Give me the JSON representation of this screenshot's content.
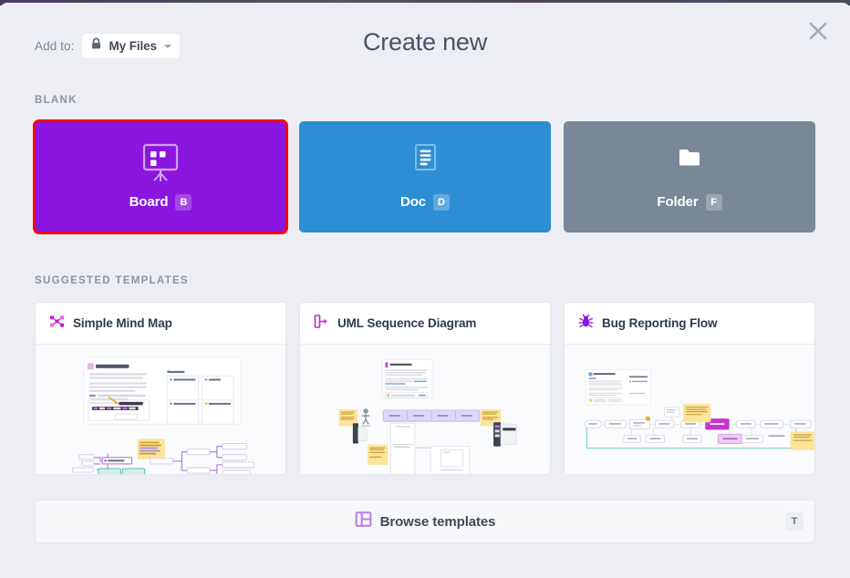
{
  "modal": {
    "title": "Create new",
    "close_icon": "close-icon"
  },
  "add_to": {
    "label": "Add to:",
    "value": "My Files",
    "icon": "lock-icon",
    "caret_icon": "chevron-down-icon"
  },
  "sections": {
    "blank_label": "BLANK",
    "suggested_label": "SUGGESTED TEMPLATES"
  },
  "blank_cards": [
    {
      "label": "Board",
      "shortcut": "B",
      "icon": "whiteboard-icon",
      "color": "#8b16e0",
      "selected": true
    },
    {
      "label": "Doc",
      "shortcut": "D",
      "icon": "document-icon",
      "color": "#2d8ed4",
      "selected": false
    },
    {
      "label": "Folder",
      "shortcut": "F",
      "icon": "folder-icon",
      "color": "#7a8796",
      "selected": false
    }
  ],
  "templates": [
    {
      "name": "Simple Mind Map",
      "icon": "mind-map-icon",
      "icon_color": "#c521cf"
    },
    {
      "name": "UML Sequence Diagram",
      "icon": "uml-sequence-icon",
      "icon_color": "#c521cf"
    },
    {
      "name": "Bug Reporting Flow",
      "icon": "bug-icon",
      "icon_color": "#8b16e0"
    }
  ],
  "browse": {
    "label": "Browse templates",
    "shortcut": "T",
    "icon": "layout-grid-icon",
    "icon_color": "#b87de8"
  },
  "selection_highlight_color": "#ff0000"
}
